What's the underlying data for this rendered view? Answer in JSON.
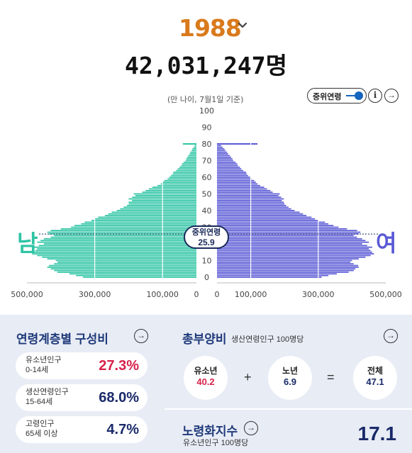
{
  "header": {
    "year": "1988",
    "total_population": "42,031,247명"
  },
  "pyramid_controls": {
    "basis_note": "(만 나이, 7월1일 기준)",
    "median_toggle_label": "중위연령",
    "info_symbol": "i",
    "go_symbol": "→"
  },
  "labels": {
    "male": "남",
    "female": "여",
    "median_title": "중위연령",
    "median_value": "25.9"
  },
  "colors": {
    "male": "#2ec4a4",
    "female": "#5a5ad6",
    "year": "#d97a1c",
    "accent_red": "#d6224a",
    "navy": "#1a2a6a"
  },
  "chart_data": {
    "type": "bar",
    "orientation": "horizontal-pyramid",
    "y_ticks": [
      "100",
      "90",
      "80",
      "70",
      "60",
      "50",
      "40",
      "30",
      "20",
      "10",
      "0"
    ],
    "x_ticks_left": [
      "500,000",
      "300,000",
      "100,000",
      "0"
    ],
    "x_ticks_right": [
      "0",
      "100,000",
      "300,000",
      "500,000"
    ],
    "ylim": [
      0,
      100
    ],
    "xlim": [
      0,
      500000
    ],
    "median_age": 25.9,
    "series": [
      {
        "name": "남",
        "values_by_age": [
          335000,
          355000,
          375000,
          410000,
          420000,
          430000,
          440000,
          435000,
          420000,
          410000,
          415000,
          440000,
          455000,
          470000,
          485000,
          480000,
          475000,
          470000,
          480000,
          465000,
          450000,
          470000,
          460000,
          450000,
          430000,
          420000,
          435000,
          440000,
          430000,
          400000,
          370000,
          360000,
          340000,
          330000,
          310000,
          300000,
          290000,
          270000,
          260000,
          250000,
          235000,
          225000,
          215000,
          205000,
          200000,
          200000,
          190000,
          200000,
          190000,
          180000,
          185000,
          160000,
          150000,
          140000,
          130000,
          115000,
          105000,
          100000,
          95000,
          85000,
          80000,
          75000,
          70000,
          68000,
          60000,
          55000,
          50000,
          45000,
          42000,
          38000,
          32000,
          30000,
          27000,
          24000,
          20000,
          18000,
          14000,
          12000,
          8000,
          5000,
          3000
        ]
      },
      {
        "name": "여",
        "values_by_age": [
          310000,
          330000,
          355000,
          390000,
          405000,
          410000,
          420000,
          418000,
          405000,
          395000,
          400000,
          420000,
          440000,
          455000,
          465000,
          460000,
          455000,
          450000,
          460000,
          445000,
          430000,
          450000,
          440000,
          430000,
          415000,
          405000,
          420000,
          425000,
          415000,
          385000,
          360000,
          345000,
          330000,
          320000,
          300000,
          290000,
          280000,
          265000,
          255000,
          245000,
          230000,
          220000,
          212000,
          205000,
          200000,
          198000,
          192000,
          198000,
          190000,
          182000,
          186000,
          165000,
          158000,
          148000,
          140000,
          128000,
          120000,
          115000,
          110000,
          102000,
          98000,
          92000,
          88000,
          86000,
          78000,
          72000,
          68000,
          62000,
          60000,
          55000,
          48000,
          46000,
          42000,
          38000,
          33000,
          30000,
          25000,
          22000,
          17000,
          12000,
          8000
        ]
      }
    ],
    "open_ended_top": {
      "male_80plus": 40000,
      "female_80plus": 120000
    }
  },
  "composition": {
    "title": "연령계층별 구성비",
    "arrow": "→",
    "rows": [
      {
        "label_line1": "유소년인구",
        "label_line2": "0-14세",
        "value": "27.3%"
      },
      {
        "label_line1": "생산연령인구",
        "label_line2": "15-64세",
        "value": "68.0%"
      },
      {
        "label_line1": "고령인구",
        "label_line2": "65세 이상",
        "value": "4.7%"
      }
    ]
  },
  "dependency": {
    "title": "총부양비",
    "subtitle": "생산연령인구 100명당",
    "arrow": "→",
    "youth_label": "유소년",
    "youth_value": "40.2",
    "old_label": "노년",
    "old_value": "6.9",
    "total_label": "전체",
    "total_value": "47.1",
    "plus": "+",
    "equals": "="
  },
  "aging_index": {
    "title": "노령화지수",
    "subtitle": "유소년인구 100명당",
    "arrow": "→",
    "value": "17.1"
  }
}
